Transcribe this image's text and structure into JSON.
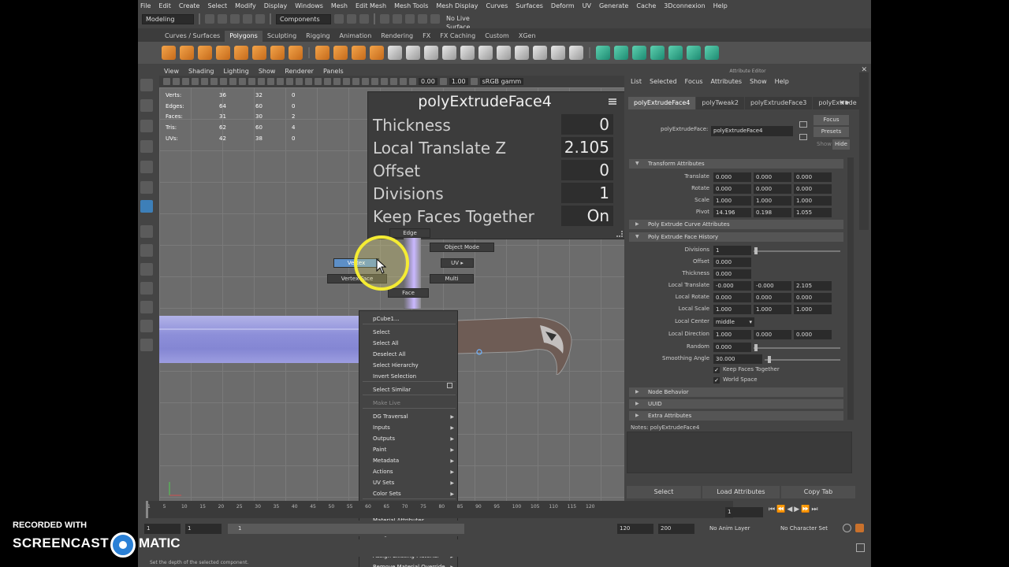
{
  "menubar": [
    "File",
    "Edit",
    "Create",
    "Select",
    "Modify",
    "Display",
    "Windows",
    "Mesh",
    "Edit Mesh",
    "Mesh Tools",
    "Mesh Display",
    "Curves",
    "Surfaces",
    "Deform",
    "UV",
    "Generate",
    "Cache",
    "3Dconnexion",
    "Help"
  ],
  "status": {
    "mode": "Modeling",
    "components": "Components",
    "live_surface": "No Live Surface"
  },
  "shelf_tabs": [
    "Curves / Surfaces",
    "Polygons",
    "Sculpting",
    "Rigging",
    "Animation",
    "Rendering",
    "FX",
    "FX Caching",
    "Custom",
    "XGen"
  ],
  "shelf_active": "Polygons",
  "viewport": {
    "menu": [
      "View",
      "Shading",
      "Lighting",
      "Show",
      "Renderer",
      "Panels"
    ],
    "toolbar_values": [
      "0.00",
      "1.00"
    ],
    "color_space": "sRGB gamm"
  },
  "hud": [
    {
      "label": "Verts:",
      "a": "36",
      "b": "32",
      "c": "0"
    },
    {
      "label": "Edges:",
      "a": "64",
      "b": "60",
      "c": "0"
    },
    {
      "label": "Faces:",
      "a": "31",
      "b": "30",
      "c": "2"
    },
    {
      "label": "Tris:",
      "a": "62",
      "b": "60",
      "c": "4"
    },
    {
      "label": "UVs:",
      "a": "42",
      "b": "38",
      "c": "0"
    }
  ],
  "extrude_panel": {
    "title": "polyExtrudeFace4",
    "rows": [
      {
        "label": "Thickness",
        "value": "0"
      },
      {
        "label": "Local Translate Z",
        "value": "2.105"
      },
      {
        "label": "Offset",
        "value": "0"
      },
      {
        "label": "Divisions",
        "value": "1"
      },
      {
        "label": "Keep Faces Together",
        "value": "On"
      }
    ]
  },
  "marking_menu": {
    "edge": "Edge",
    "object_mode": "Object Mode",
    "vertex": "Vertex",
    "uv": "UV",
    "vertex_face": "Vertex Face",
    "multi": "Multi",
    "face": "Face"
  },
  "context_menu": {
    "items": [
      {
        "label": "pCube1...",
        "arrow": false,
        "disabled": false
      },
      {
        "label": "Select",
        "arrow": false,
        "disabled": false
      },
      {
        "label": "Select All",
        "arrow": false,
        "disabled": false
      },
      {
        "label": "Deselect All",
        "arrow": false,
        "disabled": false
      },
      {
        "label": "Select Hierarchy",
        "arrow": false,
        "disabled": false
      },
      {
        "label": "Invert Selection",
        "arrow": false,
        "disabled": false
      },
      {
        "label": "Select Similar",
        "arrow": false,
        "disabled": false
      },
      {
        "label": "Make Live",
        "arrow": false,
        "disabled": true
      },
      {
        "label": "DG Traversal",
        "arrow": true,
        "disabled": false
      },
      {
        "label": "Inputs",
        "arrow": true,
        "disabled": false
      },
      {
        "label": "Outputs",
        "arrow": true,
        "disabled": false
      },
      {
        "label": "Paint",
        "arrow": true,
        "disabled": false
      },
      {
        "label": "Metadata",
        "arrow": true,
        "disabled": false
      },
      {
        "label": "Actions",
        "arrow": true,
        "disabled": false
      },
      {
        "label": "UV Sets",
        "arrow": true,
        "disabled": false
      },
      {
        "label": "Color Sets",
        "arrow": true,
        "disabled": false
      },
      {
        "label": "Scene Assembly",
        "arrow": true,
        "disabled": false
      },
      {
        "label": "Material Attributes...",
        "arrow": false,
        "disabled": false
      },
      {
        "label": "Assign New Material...",
        "arrow": false,
        "disabled": false
      },
      {
        "label": "Assign Favorite Material",
        "arrow": true,
        "disabled": false
      },
      {
        "label": "Assign Existing Material",
        "arrow": true,
        "disabled": false
      },
      {
        "label": "Remove Material Override",
        "arrow": true,
        "disabled": false
      }
    ]
  },
  "attribute_editor": {
    "header": "Attribute Editor",
    "menu": [
      "List",
      "Selected",
      "Focus",
      "Attributes",
      "Show",
      "Help"
    ],
    "tabs": [
      "polyExtrudeFace4",
      "polyTweak2",
      "polyExtrudeFace3",
      "polyExtrude"
    ],
    "node_label": "polyExtrudeFace:",
    "node_value": "polyExtrudeFace4",
    "buttons": {
      "focus": "Focus",
      "presets": "Presets",
      "show": "Show",
      "hide": "Hide"
    },
    "transform_section": "Transform Attributes",
    "translate": [
      "0.000",
      "0.000",
      "0.000"
    ],
    "rotate": [
      "0.000",
      "0.000",
      "0.000"
    ],
    "scale": [
      "1.000",
      "1.000",
      "1.000"
    ],
    "pivot": [
      "14.196",
      "0.198",
      "1.055"
    ],
    "curve_section": "Poly Extrude Curve Attributes",
    "history_section": "Poly Extrude Face History",
    "divisions": "1",
    "offset": "0.000",
    "thickness": "0.000",
    "local_translate": [
      "-0.000",
      "-0.000",
      "2.105"
    ],
    "local_rotate": [
      "0.000",
      "0.000",
      "0.000"
    ],
    "local_scale": [
      "1.000",
      "1.000",
      "1.000"
    ],
    "local_center": "middle",
    "local_direction": [
      "1.000",
      "0.000",
      "0.000"
    ],
    "random": "0.000",
    "smoothing_angle": "30.000",
    "keep_faces_together": "Keep Faces Together",
    "world_space": "World Space",
    "node_behavior": "Node Behavior",
    "uuid": "UUID",
    "extra": "Extra Attributes",
    "notes": "Notes: polyExtrudeFace4",
    "bottom": {
      "select": "Select",
      "load": "Load Attributes",
      "copy": "Copy Tab"
    },
    "labels": {
      "translate": "Translate",
      "rotate": "Rotate",
      "scale": "Scale",
      "pivot": "Pivot",
      "divisions": "Divisions",
      "offset": "Offset",
      "thickness": "Thickness",
      "local_translate": "Local Translate",
      "local_rotate": "Local Rotate",
      "local_scale": "Local Scale",
      "local_center": "Local Center",
      "local_direction": "Local Direction",
      "random": "Random",
      "smoothing_angle": "Smoothing Angle"
    }
  },
  "timeline": {
    "ticks": [
      "5",
      "10",
      "15",
      "20",
      "25",
      "30",
      "35",
      "40",
      "45",
      "50",
      "55",
      "60",
      "65",
      "70",
      "75",
      "80",
      "85",
      "90",
      "95",
      "100",
      "105",
      "110",
      "115",
      "120"
    ],
    "current_frame": "1",
    "range_start": "1",
    "range_start2": "1",
    "range_inner_start": "1",
    "range_end": "120",
    "anim_end": "200",
    "anim_layer": "No Anim Layer",
    "character_set": "No Character Set"
  },
  "help_line": "Set the depth of the selected component.",
  "watermark": {
    "line1": "RECORDED WITH",
    "line2": "SCREENCAST",
    "line3": "MATIC"
  }
}
